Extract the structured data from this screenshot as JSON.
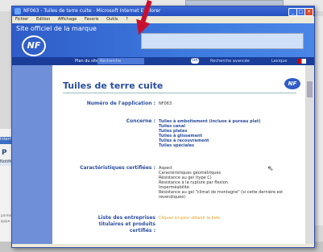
{
  "window": {
    "title": "NF063 - Tuiles de terre cuite - Microsoft Internet Explorer"
  },
  "menubar": [
    "Fichier",
    "Edition",
    "Affichage",
    "Favoris",
    "Outils",
    "?"
  ],
  "banner": {
    "site": "Site officiel de la marque",
    "logo": "NF"
  },
  "navbar": {
    "plan": "Plan du site",
    "search": "Recherche",
    "go": "OK",
    "advanced": "Recherche avancée",
    "lexicon": "Lexique"
  },
  "page": {
    "title": "Tuiles de terre cuite",
    "logo": "NF",
    "application_label": "Numéro de l'application :",
    "application_value": "NF063",
    "concerne_label": "Concerne :",
    "concerne_items": [
      "Tuiles à emboîtement (incluse à pureau plat)",
      "Tuiles canal",
      "Tuiles plates",
      "Tuiles à glissement",
      "Tuiles à recouvrement",
      "Tuiles spéciales"
    ],
    "characteristics_label": "Caractéristiques certifiées :",
    "characteristics_items": [
      "Aspect",
      "Caractéristiques géométriques",
      "Résistance au gel (type C)",
      "Résistance à la rupture par flexion",
      "Imperméabilité",
      "Résistance au gel \"climat de montagne\" (si cette dernière est",
      "revendiquée)"
    ],
    "list_label_1": "Liste des entreprises",
    "list_label_2": "titulaires et produits",
    "list_label_3": "certifiés :",
    "list_link": "Cliquez ici pour obtenir la liste"
  },
  "background": {
    "left_panel_letter": "P",
    "left_panel_bar": "Internet",
    "left_panel_nav": "Notifica",
    "left_text_1": "parme",
    "left_text_2": "quipe"
  }
}
